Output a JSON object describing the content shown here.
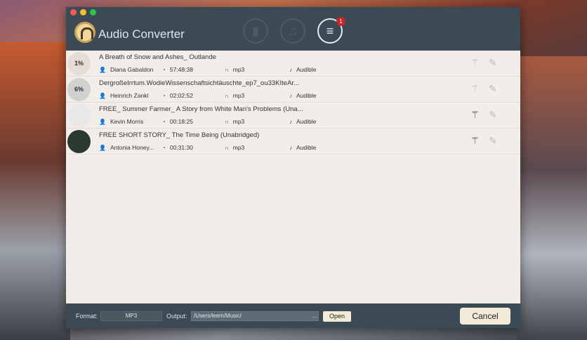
{
  "app": {
    "title": "Audio Converter",
    "badge_count": "1"
  },
  "toolbar": [
    {
      "icon": "book-icon"
    },
    {
      "icon": "music-icon"
    },
    {
      "icon": "checklist-icon",
      "active": true
    }
  ],
  "items": [
    {
      "title": "A Breath of Snow and Ashes_ Outlande",
      "author": "Diana Gabaldon",
      "duration": "57:48:38",
      "format": "mp3",
      "source": "Audible",
      "thumb": "1%",
      "thumb_color": "#e6dcd6",
      "enabled": false
    },
    {
      "title": "DergroßeIrrtum.WodieWissenschaftsichtäuschte_ep7_ou33KIteAr...",
      "author": "Heinrich Zankl",
      "duration": "02:02:52",
      "format": "mp3",
      "source": "Audible",
      "thumb": "6%",
      "thumb_color": "#cfd2cf",
      "enabled": false
    },
    {
      "title": "FREE_ Summer Farmer_ A Story from White Man's Problems (Una...",
      "author": "Kevin Morris",
      "duration": "00:18:25",
      "format": "mp3",
      "source": "Audible",
      "thumb": "",
      "thumb_color": "#e8e8e8",
      "enabled": true
    },
    {
      "title": "FREE SHORT STORY_ The Time Being (Unabridged)",
      "author": "Antonia Honey...",
      "duration": "00:31:30",
      "format": "mp3",
      "source": "Audible",
      "thumb": "",
      "thumb_color": "#2a3a30",
      "enabled": true
    }
  ],
  "footer": {
    "format_label": "Format:",
    "format_value": "MP3",
    "output_label": "Output:",
    "output_path": "/Users/leem/Music/",
    "browse": "...",
    "open": "Open",
    "cancel": "Cancel"
  }
}
